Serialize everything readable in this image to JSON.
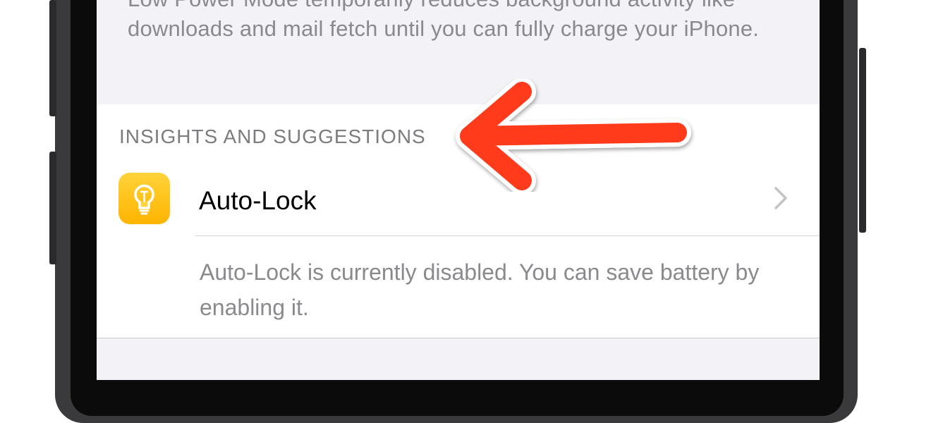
{
  "top_footer_text": "Low Power Mode temporarily reduces background activity like downloads and mail fetch until you can fully charge your iPhone.",
  "section": {
    "header": "INSIGHTS AND SUGGESTIONS"
  },
  "row": {
    "icon": "lightbulb-icon",
    "title": "Auto-Lock",
    "chevron_icon": "chevron-right-icon"
  },
  "suggestion_text": "Auto-Lock is currently disabled. You can save battery by enabling it.",
  "annotation": {
    "icon": "arrow-left-icon",
    "color": "#ff3b1f"
  },
  "colors": {
    "icon_yellow": "#ffc21a",
    "screen_background": "#f2f2f7"
  }
}
